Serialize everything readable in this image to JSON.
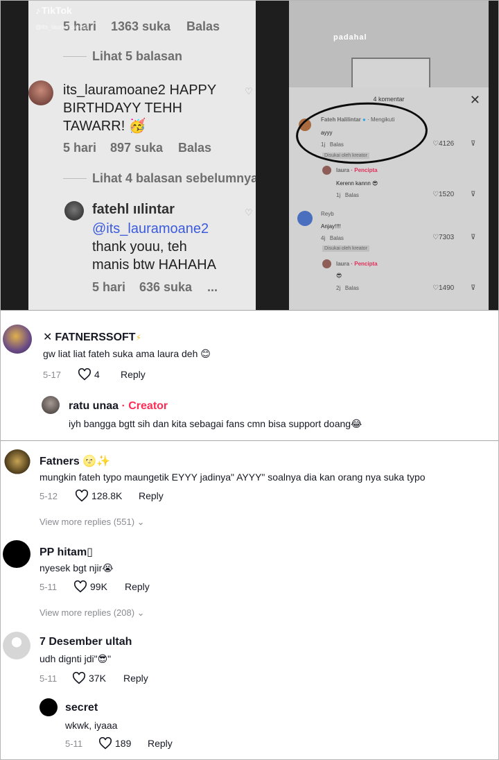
{
  "top": {
    "left_panel": {
      "watermark": "TikTok",
      "watermark_user": "@its_lauramoane2",
      "row1": {
        "time": "5 hari",
        "likes": "1363 suka",
        "reply": "Balas"
      },
      "view1": "Lihat 5 balasan",
      "c2": {
        "user": "its_lauramoane2",
        "text_l1": "HAPPY",
        "text_l2": "BIRTHDAYY TEHH",
        "text_l3": "TAWARR! 🥳",
        "time": "5 hari",
        "likes": "897 suka",
        "reply": "Balas"
      },
      "view2": "Lihat 4 balasan sebelumnya",
      "c3": {
        "user": "fatehl ıılintar",
        "mention": "@its_lauramoane2",
        "text_l2": "thank youu, teh",
        "text_l3": "manis btw HAHAHA",
        "time": "5 hari",
        "likes": "636 suka",
        "more": "..."
      }
    },
    "right_panel": {
      "caption": "padahal",
      "count": "4 komentar",
      "close": "✕",
      "r1": {
        "user": "Fateh Halilintar",
        "tag": "· Mengikuti",
        "text": "ayyy",
        "time": "1j",
        "reply": "Balas",
        "badge": "Disukai oleh kreator",
        "likes": "4126"
      },
      "r2": {
        "user": "laura",
        "tag": "· Pencipta",
        "text": "Kerenn kannn 😎",
        "time": "1j",
        "reply": "Balas",
        "likes": "1520"
      },
      "r3": {
        "user": "Reyb",
        "text": "Anjay!!!!",
        "time": "4j",
        "reply": "Balas",
        "badge": "Disukai oleh kreator",
        "likes": "7303"
      },
      "r4": {
        "user": "laura",
        "tag": "· Pencipta",
        "text": "😎",
        "time": "2j",
        "reply": "Balas",
        "likes": "1490"
      }
    }
  },
  "section2": {
    "comment": {
      "user": "FATNERSSOFT",
      "prefix": "✕",
      "suffix": "⚡",
      "text": "gw liat liat fateh suka ama laura deh 😊",
      "date": "5-17",
      "likes": "4",
      "reply": "Reply"
    },
    "reply": {
      "user": "ratu unaa",
      "creator": "· Creator",
      "text": "iyh bangga bgtt sih dan kita sebagai fans cmn bisa support doang😂"
    }
  },
  "section3": {
    "comments": [
      {
        "user": "Fatners 🌝✨",
        "text": "mungkin fateh typo maungetik EYYY jadinya\" AYYY\" soalnya dia kan orang nya suka typo",
        "date": "5-12",
        "likes": "128.8K",
        "reply": "Reply",
        "more": "View more replies (551)"
      },
      {
        "user": "PP hitam▯",
        "text": "nyesek bgt njir😭",
        "date": "5-11",
        "likes": "99K",
        "reply": "Reply",
        "more": "View more replies (208)"
      },
      {
        "user": "7 Desember ultah",
        "text": "udh dignti jdi\"😎\"",
        "date": "5-11",
        "likes": "37K",
        "reply": "Reply"
      }
    ],
    "reply": {
      "user": "secret",
      "text": "wkwk, iyaaa",
      "date": "5-11",
      "likes": "189",
      "reply": "Reply"
    }
  }
}
